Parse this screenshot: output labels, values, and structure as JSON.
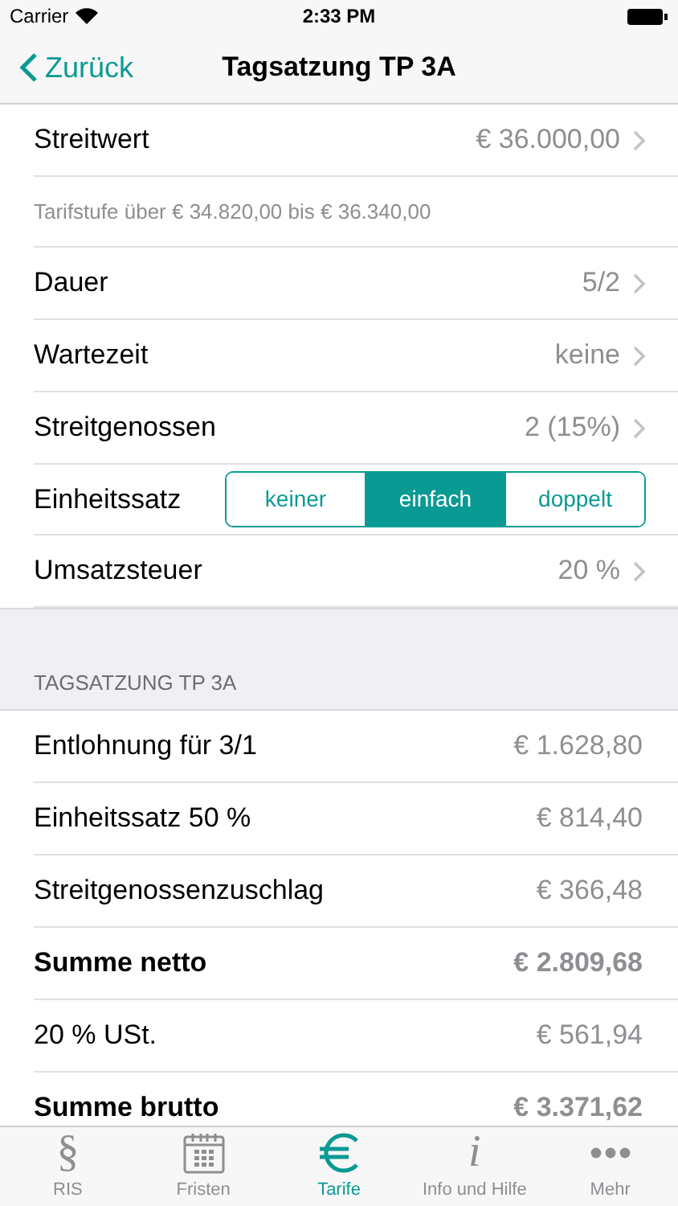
{
  "status_bar": {
    "carrier": "Carrier",
    "time": "2:33 PM"
  },
  "nav": {
    "back": "Zurück",
    "title": "Tagsatzung TP 3A"
  },
  "settings": [
    {
      "kind": "disclosure",
      "label": "Streitwert",
      "value": "€ 36.000,00"
    },
    {
      "kind": "note",
      "label": "Tarifstufe über € 34.820,00 bis € 36.340,00"
    },
    {
      "kind": "disclosure",
      "label": "Dauer",
      "value": "5/2"
    },
    {
      "kind": "disclosure",
      "label": "Wartezeit",
      "value": "keine"
    },
    {
      "kind": "disclosure",
      "label": "Streitgenossen",
      "value": "2 (15%)"
    },
    {
      "kind": "segmented",
      "label": "Einheitssatz",
      "options": [
        {
          "label": "keiner",
          "selected": false
        },
        {
          "label": "einfach",
          "selected": true
        },
        {
          "label": "doppelt",
          "selected": false
        }
      ]
    },
    {
      "kind": "disclosure",
      "label": "Umsatzsteuer",
      "value": "20 %"
    }
  ],
  "results": {
    "header": "TAGSATZUNG TP 3A",
    "rows": [
      {
        "label": "Entlohnung für 3/1",
        "value": "€ 1.628,80",
        "bold": false
      },
      {
        "label": "Einheitssatz 50 %",
        "value": "€ 814,40",
        "bold": false
      },
      {
        "label": "Streitgenossenzuschlag",
        "value": "€ 366,48",
        "bold": false
      },
      {
        "label": "Summe netto",
        "value": "€ 2.809,68",
        "bold": true
      },
      {
        "label": "20 % USt.",
        "value": "€ 561,94",
        "bold": false
      },
      {
        "label": "Summe brutto",
        "value": "€ 3.371,62",
        "bold": true
      }
    ]
  },
  "tab_bar": [
    {
      "kind": "paragraph",
      "icon": "§",
      "label": "RIS",
      "selected": false
    },
    {
      "kind": "calendar",
      "label": "Fristen",
      "selected": false
    },
    {
      "kind": "euro",
      "label": "Tarife",
      "selected": true
    },
    {
      "kind": "info",
      "icon": "i",
      "label": "Info und Hilfe",
      "selected": false
    },
    {
      "kind": "more",
      "label": "Mehr",
      "selected": false
    }
  ]
}
